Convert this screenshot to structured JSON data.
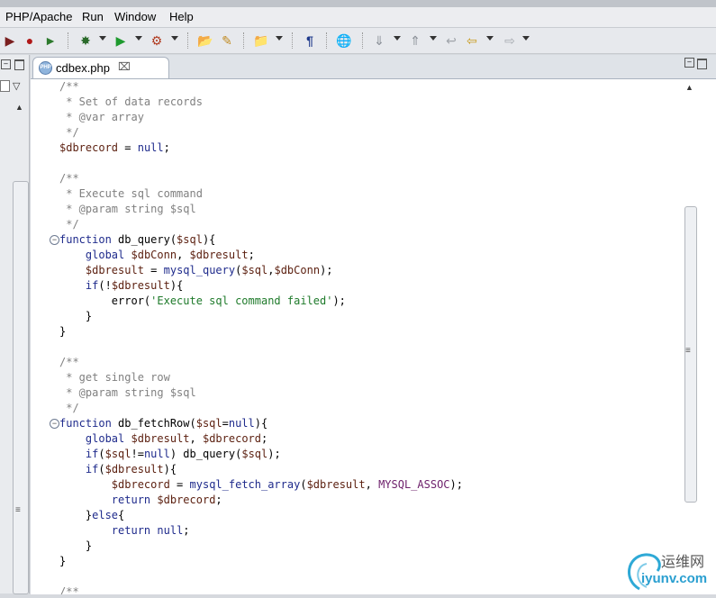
{
  "menu": [
    "PHP/Apache",
    "Run",
    "Window",
    "Help"
  ],
  "editor": {
    "tab_title": "cdbex.php",
    "lines": [
      [
        {
          "t": "/**",
          "c": "c-comment"
        }
      ],
      [
        {
          "t": " * Set of data records",
          "c": "c-comment"
        }
      ],
      [
        {
          "t": " * @var array",
          "c": "c-comment"
        }
      ],
      [
        {
          "t": " */",
          "c": "c-comment"
        }
      ],
      [
        {
          "t": "$dbrecord",
          "c": "c-var"
        },
        {
          "t": " = ",
          "c": "c-plain"
        },
        {
          "t": "null",
          "c": "c-kw"
        },
        {
          "t": ";",
          "c": "c-plain"
        }
      ],
      [],
      [
        {
          "t": "/**",
          "c": "c-comment"
        }
      ],
      [
        {
          "t": " * Execute sql command",
          "c": "c-comment"
        }
      ],
      [
        {
          "t": " * @param string $sql",
          "c": "c-comment"
        }
      ],
      [
        {
          "t": " */",
          "c": "c-comment"
        }
      ],
      [
        {
          "t": "function",
          "c": "c-kw"
        },
        {
          "t": " db_query(",
          "c": "c-plain"
        },
        {
          "t": "$sql",
          "c": "c-var"
        },
        {
          "t": "){",
          "c": "c-plain"
        }
      ],
      [
        {
          "t": "    ",
          "c": "c-plain"
        },
        {
          "t": "global",
          "c": "c-kw"
        },
        {
          "t": " ",
          "c": "c-plain"
        },
        {
          "t": "$dbConn",
          "c": "c-var"
        },
        {
          "t": ", ",
          "c": "c-plain"
        },
        {
          "t": "$dbresult",
          "c": "c-var"
        },
        {
          "t": ";",
          "c": "c-plain"
        }
      ],
      [
        {
          "t": "    ",
          "c": "c-plain"
        },
        {
          "t": "$dbresult",
          "c": "c-var"
        },
        {
          "t": " = ",
          "c": "c-plain"
        },
        {
          "t": "mysql_query",
          "c": "c-kw"
        },
        {
          "t": "(",
          "c": "c-plain"
        },
        {
          "t": "$sql",
          "c": "c-var"
        },
        {
          "t": ",",
          "c": "c-plain"
        },
        {
          "t": "$dbConn",
          "c": "c-var"
        },
        {
          "t": ");",
          "c": "c-plain"
        }
      ],
      [
        {
          "t": "    ",
          "c": "c-plain"
        },
        {
          "t": "if",
          "c": "c-kw"
        },
        {
          "t": "(!",
          "c": "c-plain"
        },
        {
          "t": "$dbresult",
          "c": "c-var"
        },
        {
          "t": "){",
          "c": "c-plain"
        }
      ],
      [
        {
          "t": "        error(",
          "c": "c-plain"
        },
        {
          "t": "'Execute sql command failed'",
          "c": "c-str"
        },
        {
          "t": ");",
          "c": "c-plain"
        }
      ],
      [
        {
          "t": "    }",
          "c": "c-plain"
        }
      ],
      [
        {
          "t": "}",
          "c": "c-plain"
        }
      ],
      [],
      [
        {
          "t": "/**",
          "c": "c-comment"
        }
      ],
      [
        {
          "t": " * get single row",
          "c": "c-comment"
        }
      ],
      [
        {
          "t": " * @param string $sql",
          "c": "c-comment"
        }
      ],
      [
        {
          "t": " */",
          "c": "c-comment"
        }
      ],
      [
        {
          "t": "function",
          "c": "c-kw"
        },
        {
          "t": " db_fetchRow(",
          "c": "c-plain"
        },
        {
          "t": "$sql",
          "c": "c-var"
        },
        {
          "t": "=",
          "c": "c-plain"
        },
        {
          "t": "null",
          "c": "c-kw"
        },
        {
          "t": "){",
          "c": "c-plain"
        }
      ],
      [
        {
          "t": "    ",
          "c": "c-plain"
        },
        {
          "t": "global",
          "c": "c-kw"
        },
        {
          "t": " ",
          "c": "c-plain"
        },
        {
          "t": "$dbresult",
          "c": "c-var"
        },
        {
          "t": ", ",
          "c": "c-plain"
        },
        {
          "t": "$dbrecord",
          "c": "c-var"
        },
        {
          "t": ";",
          "c": "c-plain"
        }
      ],
      [
        {
          "t": "    ",
          "c": "c-plain"
        },
        {
          "t": "if",
          "c": "c-kw"
        },
        {
          "t": "(",
          "c": "c-plain"
        },
        {
          "t": "$sql",
          "c": "c-var"
        },
        {
          "t": "!=",
          "c": "c-plain"
        },
        {
          "t": "null",
          "c": "c-kw"
        },
        {
          "t": ") db_query(",
          "c": "c-plain"
        },
        {
          "t": "$sql",
          "c": "c-var"
        },
        {
          "t": ");",
          "c": "c-plain"
        }
      ],
      [
        {
          "t": "    ",
          "c": "c-plain"
        },
        {
          "t": "if",
          "c": "c-kw"
        },
        {
          "t": "(",
          "c": "c-plain"
        },
        {
          "t": "$dbresult",
          "c": "c-var"
        },
        {
          "t": "){",
          "c": "c-plain"
        }
      ],
      [
        {
          "t": "        ",
          "c": "c-plain"
        },
        {
          "t": "$dbrecord",
          "c": "c-var"
        },
        {
          "t": " = ",
          "c": "c-plain"
        },
        {
          "t": "mysql_fetch_array",
          "c": "c-kw"
        },
        {
          "t": "(",
          "c": "c-plain"
        },
        {
          "t": "$dbresult",
          "c": "c-var"
        },
        {
          "t": ", ",
          "c": "c-plain"
        },
        {
          "t": "MYSQL_ASSOC",
          "c": "c-const"
        },
        {
          "t": ");",
          "c": "c-plain"
        }
      ],
      [
        {
          "t": "        ",
          "c": "c-plain"
        },
        {
          "t": "return",
          "c": "c-kw"
        },
        {
          "t": " ",
          "c": "c-plain"
        },
        {
          "t": "$dbrecord",
          "c": "c-var"
        },
        {
          "t": ";",
          "c": "c-plain"
        }
      ],
      [
        {
          "t": "    }",
          "c": "c-plain"
        },
        {
          "t": "else",
          "c": "c-kw"
        },
        {
          "t": "{",
          "c": "c-plain"
        }
      ],
      [
        {
          "t": "        ",
          "c": "c-plain"
        },
        {
          "t": "return",
          "c": "c-kw"
        },
        {
          "t": " ",
          "c": "c-plain"
        },
        {
          "t": "null",
          "c": "c-kw"
        },
        {
          "t": ";",
          "c": "c-plain"
        }
      ],
      [
        {
          "t": "    }",
          "c": "c-plain"
        }
      ],
      [
        {
          "t": "}",
          "c": "c-plain"
        }
      ],
      [],
      [
        {
          "t": "/**",
          "c": "c-comment"
        }
      ]
    ]
  },
  "watermark": {
    "cn": "运维网",
    "site": "iyunv.com"
  }
}
